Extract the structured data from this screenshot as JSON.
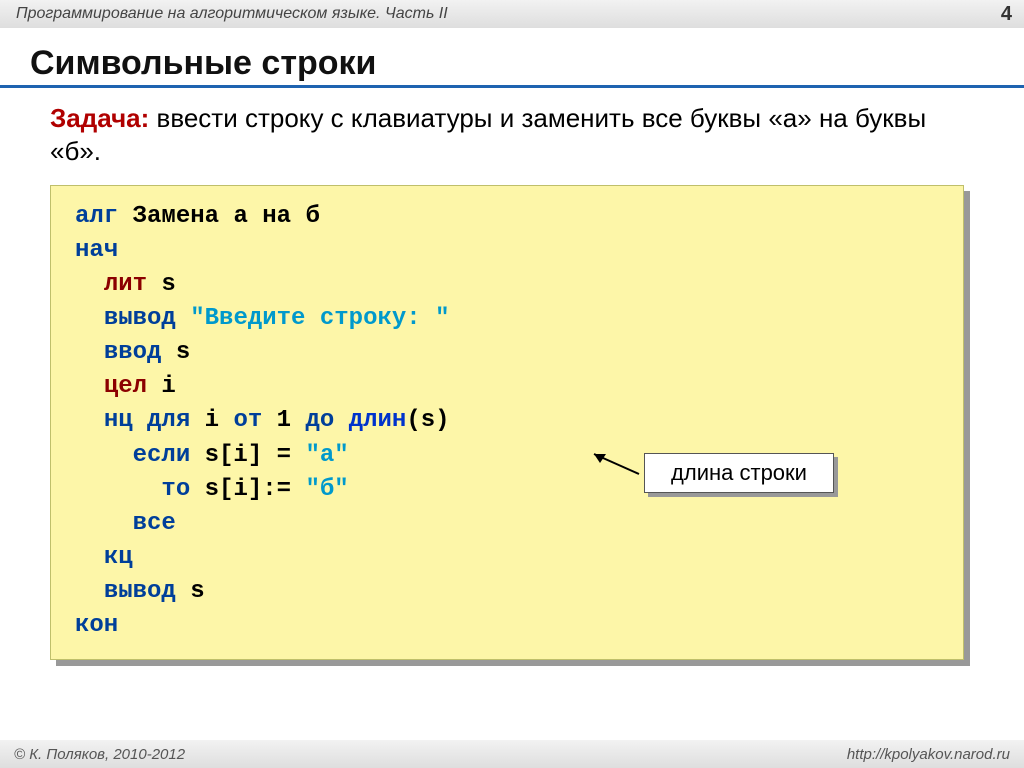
{
  "header": {
    "title": "Программирование на алгоритмическом языке. Часть II",
    "page": "4"
  },
  "title": "Символьные строки",
  "task": {
    "label": "Задача:",
    "text": " ввести строку с клавиатуры и заменить все буквы «а» на буквы «б»."
  },
  "code": {
    "l1_alg": "алг",
    "l1_name": " Замена а на б",
    "l2": "нач",
    "l3_kw": "лит",
    "l3_rest": " s",
    "l4_kw": "вывод",
    "l4_sp": " ",
    "l4_str": "\"Введите строку: \"",
    "l5_kw": "ввод",
    "l5_rest": " s",
    "l6_kw": "цел",
    "l6_rest": " i",
    "l7_a": "нц для",
    "l7_mid": " i ",
    "l7_b": "от",
    "l7_mid2": " 1 ",
    "l7_c": "до",
    "l7_sp": " ",
    "l7_fn": "длин",
    "l7_end": "(s)",
    "l8_kw": "если",
    "l8_mid": " s[i] = ",
    "l8_str": "\"а\"",
    "l9_kw": "то",
    "l9_mid": " s[i]:= ",
    "l9_str": "\"б\"",
    "l10": "все",
    "l11": "кц",
    "l12_kw": "вывод",
    "l12_rest": " s",
    "l13": "кон"
  },
  "note": "длина строки",
  "footer": {
    "left": "© К. Поляков, 2010-2012",
    "right": "http://kpolyakov.narod.ru"
  }
}
